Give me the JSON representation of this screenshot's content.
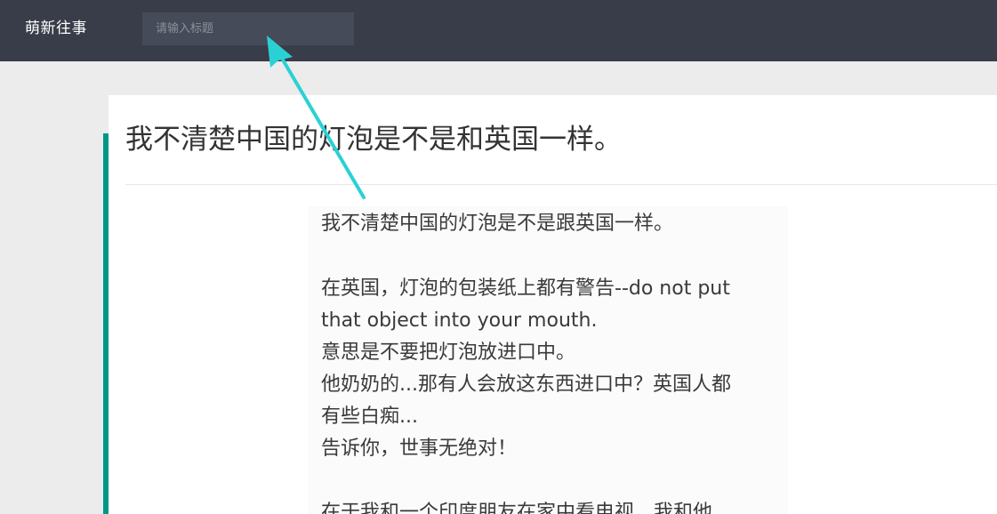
{
  "header": {
    "brand": "萌新往事",
    "search_placeholder": "请输入标题"
  },
  "post": {
    "title": "我不清楚中国的灯泡是不是和英国一样。",
    "image_text": [
      "我不清楚中国的灯泡是不是跟英国一样。",
      "在英国，灯泡的包装纸上都有警告--do not put",
      "that object into your mouth.",
      "意思是不要把灯泡放进口中。",
      "他奶奶的...那有人会放这东西进口中？英国人都",
      "有些白痴...",
      "告诉你，世事无绝对！",
      "在于我和一个印度朋友在家中看电视，我和他"
    ]
  },
  "colors": {
    "topbar": "#393d49",
    "search_bg": "#464b59",
    "accent": "#009688",
    "annotation_arrow": "#2ad1d4"
  },
  "annotation": {
    "icon": "arrow-pointer-icon"
  }
}
